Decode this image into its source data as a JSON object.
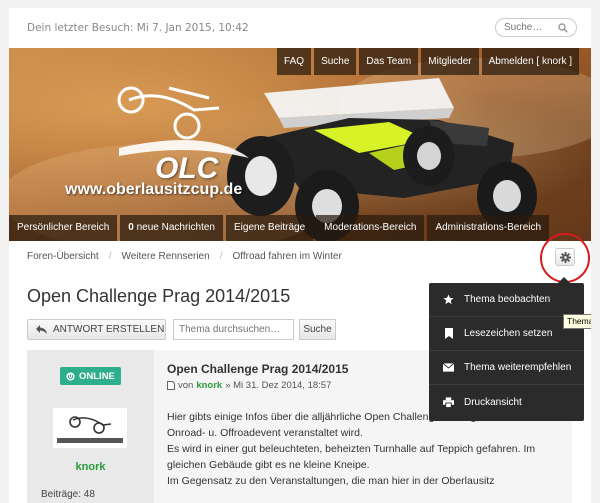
{
  "header": {
    "last_visit": "Dein letzter Besuch: Mi 7. Jan 2015, 10:42",
    "search_placeholder": "Suche…"
  },
  "banner": {
    "logo_big": "OLC",
    "logo_text": "www.oberlausitzcup.de"
  },
  "top_nav": [
    "FAQ",
    "Suche",
    "Das Team",
    "Mitglieder",
    "Abmelden [ knork ]"
  ],
  "sub_nav": {
    "personal": "Persönlicher Bereich",
    "messages_count": "0",
    "messages_label": " neue Nachrichten",
    "own_posts": "Eigene Beiträge",
    "moderation": "Moderations-Bereich",
    "admin": "Administrations-Bereich"
  },
  "breadcrumb": [
    "Foren-Übersicht",
    "Weitere Rennserien",
    "Offroad fahren im Winter"
  ],
  "thread": {
    "title": "Open Challenge Prag 2014/2015",
    "reply_label": "ANTWORT ERSTELLEN",
    "search_placeholder": "Thema durchsuchen…",
    "search_button": "Suche"
  },
  "post": {
    "status": "ONLINE",
    "author": "knork",
    "posts_label": "Beiträge: 48",
    "title": "Open Challenge Prag 2014/2015",
    "meta_by": "von",
    "meta_user": "knork",
    "meta_date": "» Mi 31. Dez 2014, 18:57",
    "text": [
      "Hier gibts einige Infos über die alljährliche Open Challenge in Prag, welche als",
      "Onroad- u. Offroadevent veranstaltet wird.",
      "Es wird in einer gut beleuchteten, beheizten Turnhalle auf Teppich gefahren. Im",
      "gleichen Gebäude gibt es ne kleine Kneipe.",
      "Im Gegensatz zu den Veranstaltungen, die man hier in der Oberlausitz"
    ]
  },
  "dropdown": {
    "items": [
      "Thema beobachten",
      "Lesezeichen setzen",
      "Thema weiterempfehlen",
      "Druckansicht"
    ]
  },
  "tooltip": "Thema be",
  "colors": {
    "accent_green": "#2eae8d",
    "username_green": "#2a9c3a",
    "highlight_red": "#d91a1a"
  }
}
